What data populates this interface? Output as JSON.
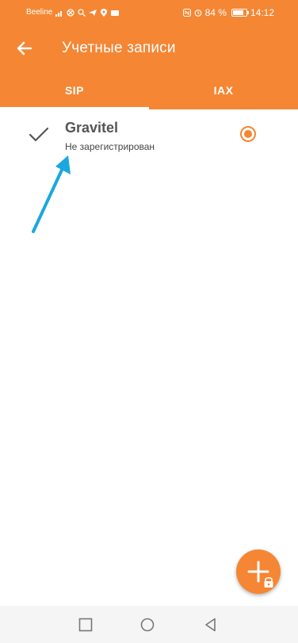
{
  "status_bar": {
    "carrier": "Beeline",
    "battery_text": "84 %",
    "battery_level": 0.84,
    "time": "14:12"
  },
  "app_bar": {
    "title": "Учетные записи",
    "back_icon": "arrow-left-icon"
  },
  "tabs": [
    {
      "label": "SIP",
      "selected": true
    },
    {
      "label": "IAX",
      "selected": false
    }
  ],
  "accounts": [
    {
      "name": "Gravitel",
      "status": "Не зарегистрирован",
      "active": true,
      "default": true
    }
  ],
  "fab": {
    "icon": "add-locked-icon"
  },
  "nav_bar": {
    "icons": [
      "back-triangle-icon",
      "home-circle-icon",
      "recent-square-icon"
    ]
  },
  "colors": {
    "accent": "#f58634",
    "annotation_arrow": "#1aa7e0"
  }
}
